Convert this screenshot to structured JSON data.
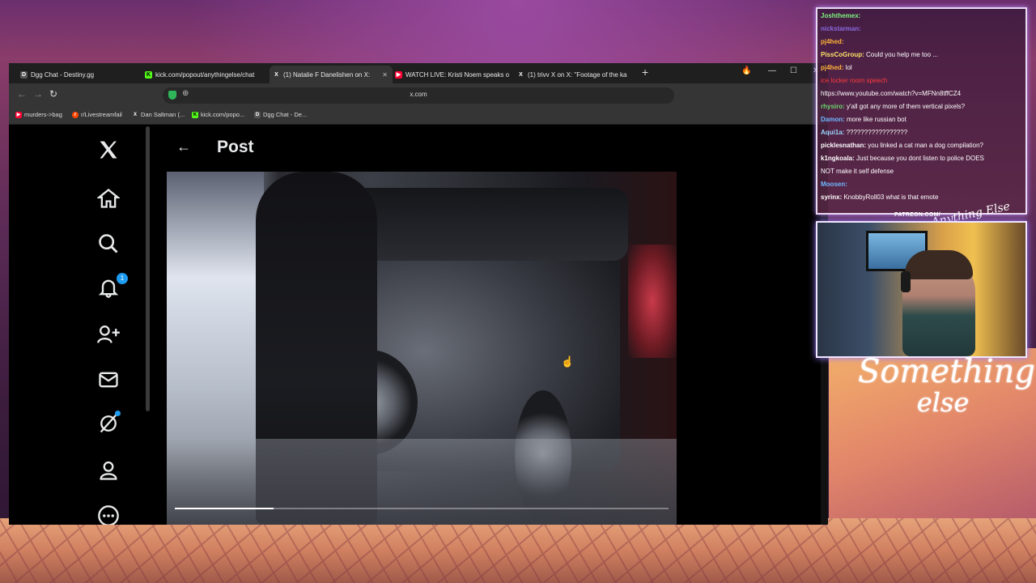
{
  "browser": {
    "tabs": [
      {
        "title": "Dgg Chat - Destiny.gg",
        "icon": "destiny-icon",
        "color": "#cccccc",
        "active": false
      },
      {
        "title": "kick.com/popout/anythingelse/chat",
        "icon": "kick-icon",
        "color": "#53fc18",
        "active": false
      },
      {
        "title": "(1) Natalie F Danelishen on X:",
        "icon": "x-icon",
        "color": "#ffffff",
        "active": true
      },
      {
        "title": "WATCH LIVE: Kristi Noem speaks o",
        "icon": "youtube-icon",
        "color": "#ff0033",
        "active": false
      },
      {
        "title": "(1) trivv X on X: \"Footage of the ka",
        "icon": "x-icon",
        "color": "#ffffff",
        "active": false
      }
    ],
    "new_tab": "+",
    "window_controls": {
      "minimize": "—",
      "maximize": "☐",
      "close": "✕"
    },
    "nav": {
      "back": "←",
      "forward": "→",
      "reload": "↻"
    },
    "url": "x.com",
    "bookmarks": [
      {
        "label": "murders->bag",
        "color": "#ff0033",
        "icon": "youtube-icon"
      },
      {
        "label": "r/Livestreamfail",
        "color": "#ff4500",
        "icon": "reddit-icon"
      },
      {
        "label": "Dan Saltman (...",
        "color": "#ffffff",
        "icon": "x-icon"
      },
      {
        "label": "kick.com/popo...",
        "color": "#53fc18",
        "icon": "kick-icon"
      },
      {
        "label": "Dgg Chat - De...",
        "color": "#cccccc",
        "icon": "destiny-icon"
      }
    ]
  },
  "x": {
    "nav_items": [
      {
        "name": "x-logo-icon",
        "glyph": "𝕏"
      },
      {
        "name": "home-icon",
        "glyph": "⌂"
      },
      {
        "name": "search-icon",
        "glyph": "⚲"
      },
      {
        "name": "notifications-icon",
        "glyph": "🔔",
        "badge": "1"
      },
      {
        "name": "follow-icon",
        "glyph": "👤+"
      },
      {
        "name": "messages-icon",
        "glyph": "✉"
      },
      {
        "name": "grok-icon",
        "glyph": "Ø",
        "dot": true
      },
      {
        "name": "profile-icon",
        "glyph": "👤"
      },
      {
        "name": "more-icon",
        "glyph": "⋯"
      }
    ],
    "header": {
      "back": "←",
      "title": "Post"
    },
    "video_progress": 0.2,
    "accent": "#1d9bf0"
  },
  "overlay": {
    "chat": [
      {
        "user": "Joshthemex:",
        "color": "#7cf57c",
        "text": ""
      },
      {
        "user": "nickstarman:",
        "color": "#8a6be0",
        "text": ""
      },
      {
        "user": "pj4hed:",
        "color": "#ffb33a",
        "text": ""
      },
      {
        "user": "PissCoGroup:",
        "color": "#ffe26a",
        "text": "Could you help me too ..."
      },
      {
        "user": "pj4hed:",
        "color": "#ffb33a",
        "text": "lol"
      },
      {
        "user": "",
        "color": "#ff3b3b",
        "text": "ice locker room speech"
      },
      {
        "user": "",
        "color": "#ffffff",
        "text": "https://www.youtube.com/watch?v=MFNn8tffCZ4"
      },
      {
        "user": "rhysiro:",
        "color": "#6bd86b",
        "text": "y'all got any more of them vertical pixels?"
      },
      {
        "user": "Damon:",
        "color": "#6fb7ff",
        "text": "more like russian bot"
      },
      {
        "user": "Aqui1a:",
        "color": "#9ad6ff",
        "text": "?????????????????"
      },
      {
        "user": "picklesnathan:",
        "color": "#ffffff",
        "text": "you linked a cat man a dog compilation?"
      },
      {
        "user": "k1ngkoala:",
        "color": "#ffffff",
        "text": "Just because you dont listen to police DOES"
      },
      {
        "user": "",
        "color": "#ffffff",
        "text": "NOT make it self defense"
      },
      {
        "user": "Moosen:",
        "color": "#6fb7ff",
        "text": ""
      },
      {
        "user": "syrinx:",
        "color": "#ffffff",
        "text": "KnobbyRoll03 what is that emote"
      }
    ],
    "patreon": "PATREON.COM/",
    "brand_script": "Anything Else",
    "something_else_line1": "Something",
    "something_else_line2": "else"
  }
}
